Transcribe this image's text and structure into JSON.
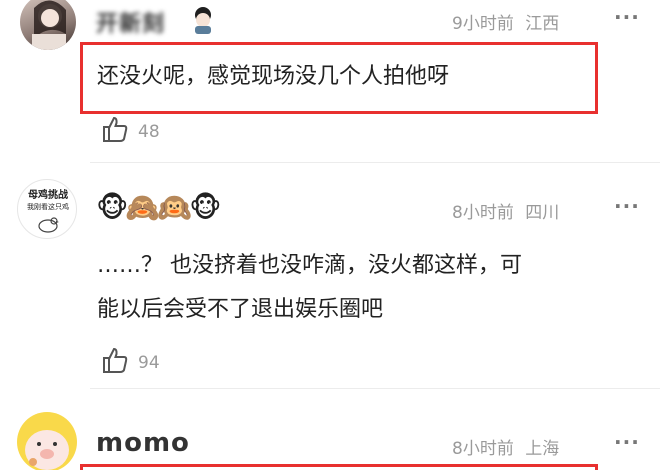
{
  "comments": [
    {
      "name": "开新刻",
      "time": "9小时前",
      "location": "江西",
      "text": "还没火呢，感觉现场没几个人拍他呀",
      "likes": "48",
      "more": "···"
    },
    {
      "avatar_caption_top": "母鸡挑战",
      "avatar_caption_bottom": "我刚看这只鸡",
      "emoji": "🐵🙈🙉🐵",
      "time": "8小时前",
      "location": "四川",
      "text_line1": "……？ 也没挤着也没咋滴，没火都这样，可",
      "text_line2": "能以后会受不了退出娱乐圈吧",
      "likes": "94",
      "more": "···"
    },
    {
      "name": "momo",
      "time": "8小时前",
      "location": "上海",
      "more": "···"
    }
  ],
  "colors": {
    "highlight": "#e8302f",
    "meta": "#9a9a9a",
    "text": "#222222"
  }
}
